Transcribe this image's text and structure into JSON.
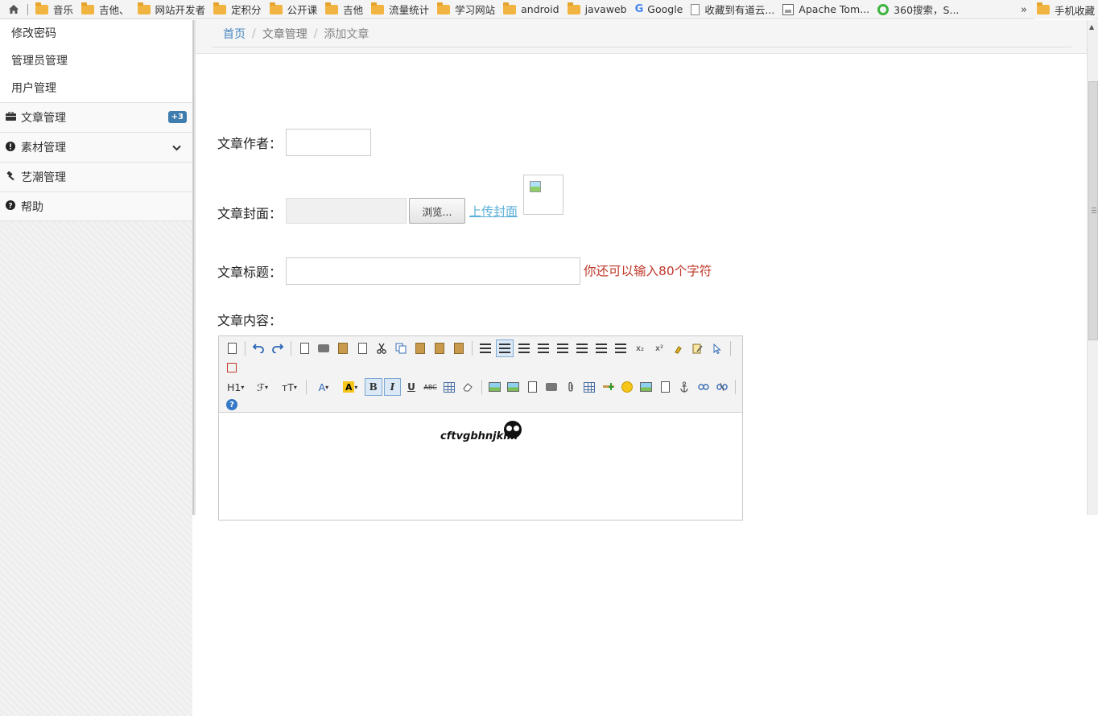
{
  "bookmarks": {
    "items": [
      {
        "label": "音乐",
        "icon": "folder-icon"
      },
      {
        "label": "吉他、",
        "icon": "folder-icon"
      },
      {
        "label": "网站开发者",
        "icon": "folder-icon"
      },
      {
        "label": "定积分",
        "icon": "folder-icon"
      },
      {
        "label": "公开课",
        "icon": "folder-icon"
      },
      {
        "label": "吉他",
        "icon": "folder-icon"
      },
      {
        "label": "流量统计",
        "icon": "folder-icon"
      },
      {
        "label": "学习网站",
        "icon": "folder-icon"
      },
      {
        "label": "android",
        "icon": "folder-icon"
      },
      {
        "label": "javaweb",
        "icon": "folder-icon"
      },
      {
        "label": "Google",
        "icon": "google-icon"
      },
      {
        "label": "收藏到有道云...",
        "icon": "page-icon"
      },
      {
        "label": "Apache Tom...",
        "icon": "tomcat-icon"
      },
      {
        "label": "360搜索，S...",
        "icon": "360-search-icon"
      }
    ],
    "more": "»",
    "right_folder": "手机收藏"
  },
  "sidebar": {
    "sub_items": [
      "修改密码",
      "管理员管理",
      "用户管理"
    ],
    "items": [
      {
        "label": "文章管理",
        "icon": "briefcase-icon",
        "badge": "+3"
      },
      {
        "label": "素材管理",
        "icon": "exclamation-circle-icon",
        "chevron": "⌄"
      },
      {
        "label": "艺潮管理",
        "icon": "gavel-icon"
      },
      {
        "label": "帮助",
        "icon": "question-circle-icon"
      }
    ]
  },
  "breadcrumb": {
    "home": "首页",
    "separator": "/",
    "section": "文章管理",
    "current": "添加文章"
  },
  "form": {
    "author_label": "文章作者：",
    "author_value": "",
    "cover_label": "文章封面：",
    "browse_button": "浏览...",
    "upload_link": "上传封面",
    "title_label": "文章标题：",
    "title_value": "",
    "title_hint": "你还可以输入80个字符",
    "content_label": "文章内容："
  },
  "editor": {
    "heading_button": "H1",
    "font_family_button": "ℱ",
    "font_size_button": "ᴛT",
    "font_color_button": "A",
    "highlight_button": "A",
    "bold": "B",
    "italic": "I",
    "underline": "U",
    "strikethrough": "ABC",
    "subscript": "x₂",
    "superscript": "x²",
    "content_text": "cftvgbhnjkml"
  },
  "colors": {
    "link": "#4a87c0",
    "hint": "#c0392b",
    "badge": "#3f7dae",
    "upload_link": "#5aaed8"
  }
}
